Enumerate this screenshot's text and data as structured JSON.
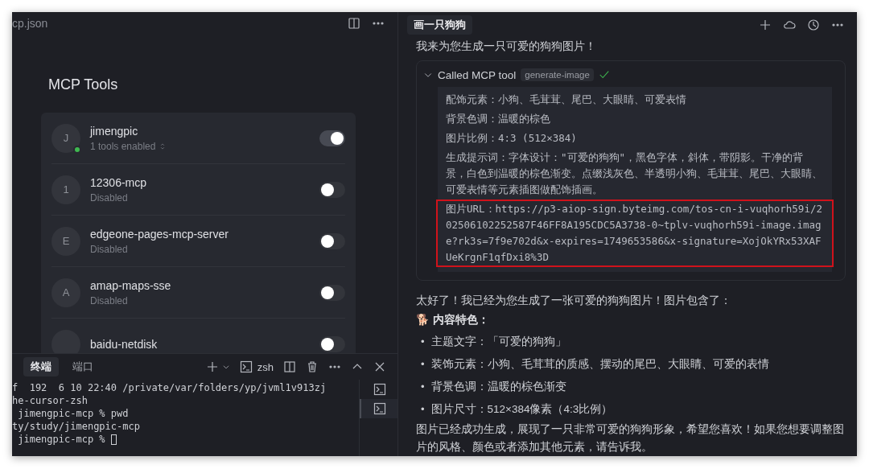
{
  "editor": {
    "tab_title": "cp.json",
    "heading": "MCP Tools"
  },
  "servers": [
    {
      "initial": "J",
      "name": "jimengpic",
      "status": "1 tools enabled",
      "on": true,
      "connected": true
    },
    {
      "initial": "1",
      "name": "12306-mcp",
      "status": "Disabled",
      "on": false,
      "connected": false
    },
    {
      "initial": "E",
      "name": "edgeone-pages-mcp-server",
      "status": "Disabled",
      "on": false,
      "connected": false
    },
    {
      "initial": "A",
      "name": "amap-maps-sse",
      "status": "Disabled",
      "on": false,
      "connected": false
    },
    {
      "name": "baidu-netdisk",
      "on": false
    }
  ],
  "terminal": {
    "tabs": [
      {
        "label": "终端",
        "selected": true
      },
      {
        "label": "端口",
        "selected": false
      }
    ],
    "shell": "zsh",
    "lines": [
      "f  192  6 10 22:40 /private/var/folders/yp/jvml1v913zj",
      "he-cursor-zsh",
      " jimengpic-mcp % pwd",
      "ty/study/jimengpic-mcp",
      " jimengpic-mcp % "
    ],
    "sessions": [
      {
        "selected": false
      },
      {
        "selected": true
      }
    ]
  },
  "chat": {
    "title": "画一只狗狗",
    "intro": "我来为您生成一只可爱的狗狗图片！",
    "tool_call": {
      "label": "Called MCP tool",
      "tool": "generate-image",
      "expanded": true,
      "done": true,
      "lines": [
        {
          "text": "配饰元素：小狗、毛茸茸、尾巴、大眼睛、可爱表情",
          "highlighted": false
        },
        {
          "text": "背景色调：温暖的棕色",
          "highlighted": false
        },
        {
          "text": "图片比例：4:3 (512×384)",
          "highlighted": false
        },
        {
          "text": "生成提示词：字体设计：\"可爱的狗狗\"，黑色字体，斜体，带阴影。干净的背景，白色到温暖的棕色渐变。点缀浅灰色、半透明小狗、毛茸茸、尾巴、大眼睛、可爱表情等元素插图做配饰插画。",
          "highlighted": false
        },
        {
          "text": "图片URL：https://p3-aiop-sign.byteimg.com/tos-cn-i-vuqhorh59i/202506102252587F46FF8A195CDC5A3738-0~tplv-vuqhorh59i-image.image?rk3s=7f9e702d&x-expires=1749653586&x-signature=XojOkYRx53XAFUeKrgnF1qfDxi8%3D",
          "highlighted": true
        }
      ]
    },
    "reply": "太好了！我已经为您生成了一张可爱的狗狗图片！图片包含了：",
    "section": "🐕 内容特色：",
    "bullets": [
      {
        "marker": "•",
        "text": "主题文字：「可爱的狗狗」"
      },
      {
        "marker": "•",
        "text": "装饰元素：小狗、毛茸茸的质感、摆动的尾巴、大眼睛、可爱的表情"
      },
      {
        "marker": "•",
        "text": "背景色调：温暖的棕色渐变"
      },
      {
        "marker": "•",
        "text": "图片尺寸：512×384像素（4:3比例）"
      }
    ],
    "closing": "图片已经成功生成，展现了一只非常可爱的狗狗形象，希望您喜欢！如果您想要调整图片的风格、颜色或者添加其他元素，请告诉我。"
  }
}
